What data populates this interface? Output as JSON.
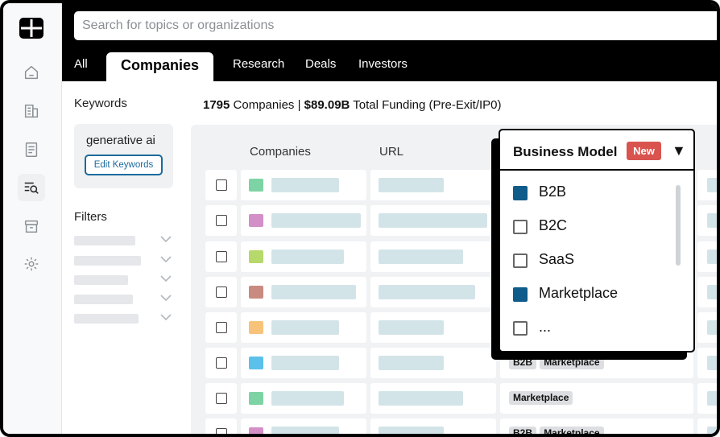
{
  "search": {
    "placeholder": "Search for topics or organizations"
  },
  "tabs": [
    {
      "label": "All",
      "active": false
    },
    {
      "label": "Companies",
      "active": true
    },
    {
      "label": "Research",
      "active": false
    },
    {
      "label": "Deals",
      "active": false
    },
    {
      "label": "Investors",
      "active": false
    }
  ],
  "sidebar": {
    "icons": [
      "home-icon",
      "building-icon",
      "document-icon",
      "search-list-icon",
      "archive-icon",
      "gear-icon"
    ],
    "active": "search-list-icon"
  },
  "panel": {
    "keywords_heading": "Keywords",
    "keyword": "generative ai",
    "edit_keywords": "Edit Keywords",
    "filters_heading": "Filters"
  },
  "summary": {
    "count": "1795",
    "count_label": "Companies |",
    "funding": "$89.09B",
    "funding_label": "Total Funding (Pre-Exit/IP0)"
  },
  "table": {
    "columns": [
      "Companies",
      "URL"
    ],
    "row_colors": [
      "#7dd3a4",
      "#d38fc7",
      "#b7d86a",
      "#c98a80",
      "#f7c37a",
      "#5bc0ea",
      "#7dd3a4",
      "#d38fc7"
    ],
    "row_tags": [
      [],
      [],
      [],
      [],
      [],
      [
        "B2B",
        "Marketplace"
      ],
      [
        "Marketplace"
      ],
      [
        "B2B",
        "Marketplace"
      ]
    ]
  },
  "dropdown": {
    "title": "Business Model",
    "badge": "New",
    "options": [
      {
        "label": "B2B",
        "checked": true
      },
      {
        "label": "B2C",
        "checked": false
      },
      {
        "label": "SaaS",
        "checked": false
      },
      {
        "label": "Marketplace",
        "checked": true
      },
      {
        "label": "...",
        "checked": false
      }
    ]
  },
  "colors": {
    "accent": "#0f5b8a",
    "badge": "#d9534f",
    "placeholder": "#d3e4e9"
  }
}
